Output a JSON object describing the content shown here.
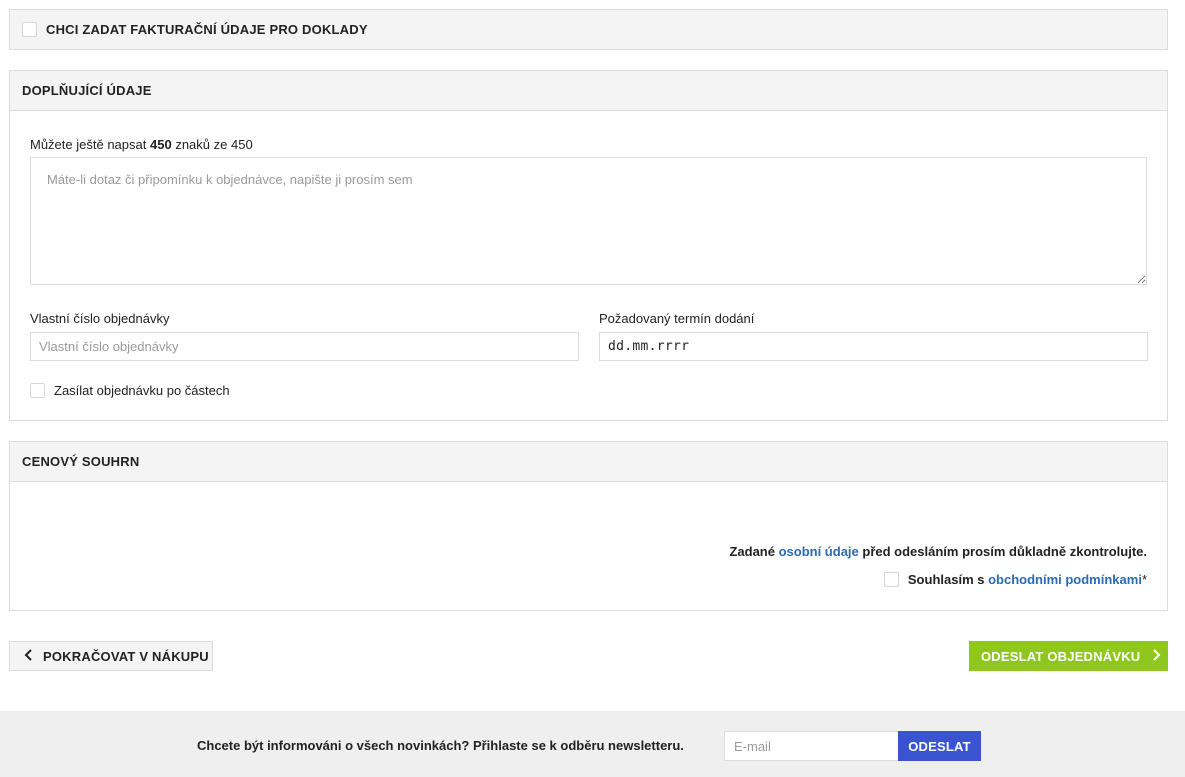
{
  "invoice": {
    "label": "CHCI ZADAT FAKTURAČNÍ ÚDAJE PRO DOKLADY",
    "checked": false
  },
  "extra": {
    "title": "DOPLŇUJÍCÍ ÚDAJE",
    "counter_prefix": "Můžete ještě napsat",
    "counter_remaining": "450",
    "counter_middle": "znaků ze",
    "counter_max": "450",
    "note_placeholder": "Máte-li dotaz či připomínku k objednávce, napište ji prosím sem",
    "order_number_label": "Vlastní číslo objednávky",
    "order_number_placeholder": "Vlastní číslo objednávky",
    "delivery_date_label": "Požadovaný termín dodání",
    "delivery_date_value": "dd.mm.rrrr",
    "partial_label": "Zasílat objednávku po částech"
  },
  "price": {
    "title": "CENOVÝ SOUHRN",
    "notice_prefix": "Zadané",
    "notice_link": "osobní údaje",
    "notice_suffix": "před odesláním prosím důkladně zkontrolujte.",
    "agree_prefix": "Souhlasím s",
    "agree_link": "obchodními podmínkami",
    "agree_star": "*"
  },
  "actions": {
    "back_label": "POKRAČOVAT V NÁKUPU",
    "back_icon": "chevron-left-icon",
    "submit_label": "ODESLAT OBJEDNÁVKU",
    "submit_icon": "chevron-right-icon",
    "submit_color": "#8fc71e"
  },
  "newsletter": {
    "text": "Chcete být informováni o všech novinkách? Přihlaste se k odběru newsletteru.",
    "email_placeholder": "E-mail",
    "button_label": "ODESLAT",
    "button_color": "#3a54d1"
  },
  "colors": {
    "link": "#2a6bb5",
    "panel_header_bg": "#f4f4f4",
    "border": "#dcdcdc"
  }
}
